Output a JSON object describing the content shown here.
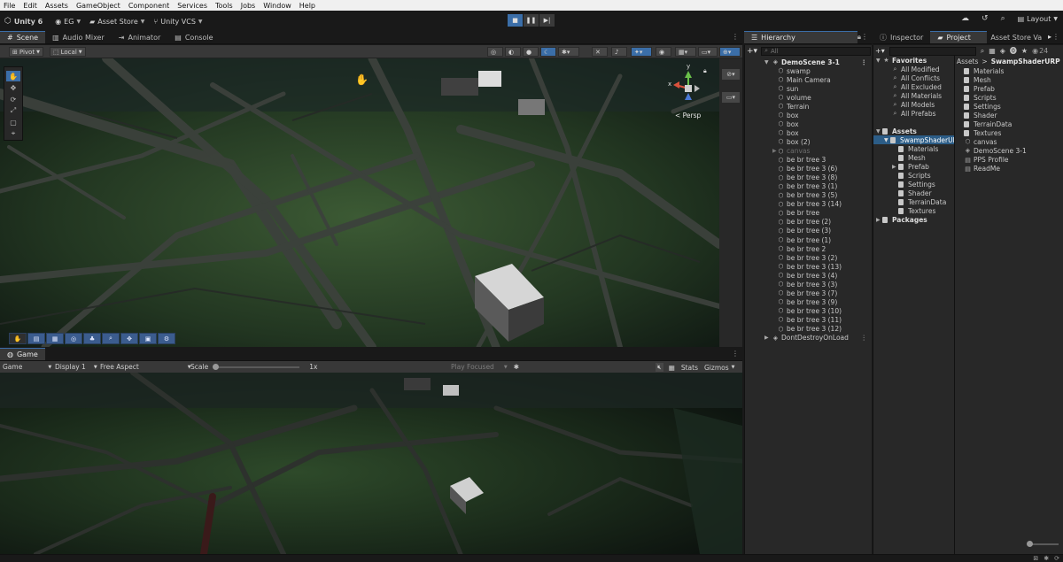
{
  "menu": [
    "File",
    "Edit",
    "Assets",
    "GameObject",
    "Component",
    "Services",
    "Tools",
    "Jobs",
    "Window",
    "Help"
  ],
  "toolbar": {
    "unity_label": "Unity 6",
    "account_label": "EG",
    "asset_store_label": "Asset Store",
    "vcs_label": "Unity VCS",
    "layout_label": "Layout"
  },
  "left_tabs": [
    {
      "label": "Scene",
      "icon": "scene-icon"
    },
    {
      "label": "Audio Mixer",
      "icon": "audio-mixer-icon"
    },
    {
      "label": "Animator",
      "icon": "animator-icon"
    },
    {
      "label": "Console",
      "icon": "console-icon"
    }
  ],
  "scene_toolbar": {
    "pivot_label": "Pivot",
    "local_label": "Local"
  },
  "gizmo": {
    "persp_label": "< Persp",
    "y_label": "y",
    "x_label": "x"
  },
  "game_tab": {
    "label": "Game"
  },
  "game_toolbar": {
    "game_label": "Game",
    "display_label": "Display 1",
    "aspect_label": "Free Aspect",
    "scale_label": "Scale",
    "scale_value": "1x",
    "play_focused_label": "Play Focused",
    "stats_label": "Stats",
    "gizmos_label": "Gizmos"
  },
  "hierarchy": {
    "tab_label": "Hierarchy",
    "search_placeholder": "All",
    "scene_name": "DemoScene 3-1",
    "items": [
      {
        "label": "swamp"
      },
      {
        "label": "Main Camera"
      },
      {
        "label": "sun"
      },
      {
        "label": "volume"
      },
      {
        "label": "Terrain"
      },
      {
        "label": "box"
      },
      {
        "label": "box"
      },
      {
        "label": "box"
      },
      {
        "label": "box (2)"
      },
      {
        "label": "canvas",
        "dim": true
      },
      {
        "label": "be br tree 3"
      },
      {
        "label": "be br tree 3 (6)"
      },
      {
        "label": "be br tree 3 (8)"
      },
      {
        "label": "be br tree 3 (1)"
      },
      {
        "label": "be br tree 3 (5)"
      },
      {
        "label": "be br tree 3 (14)"
      },
      {
        "label": "be br tree"
      },
      {
        "label": "be br tree (2)"
      },
      {
        "label": "be br tree (3)"
      },
      {
        "label": "be br tree (1)"
      },
      {
        "label": "be br tree 2"
      },
      {
        "label": "be br tree 3 (2)"
      },
      {
        "label": "be br tree 3 (13)"
      },
      {
        "label": "be br tree 3 (4)"
      },
      {
        "label": "be br tree 3 (3)"
      },
      {
        "label": "be br tree 3 (7)"
      },
      {
        "label": "be br tree 3 (9)"
      },
      {
        "label": "be br tree 3 (10)"
      },
      {
        "label": "be br tree 3 (11)"
      },
      {
        "label": "be br tree 3 (12)"
      }
    ],
    "dont_destroy": "DontDestroyOnLoad"
  },
  "right_tabs": {
    "inspector": "Inspector",
    "project": "Project",
    "asset_store": "Asset Store Va"
  },
  "project": {
    "count_label": "24",
    "favorites_label": "Favorites",
    "favorites": [
      "All Modified",
      "All Conflicts",
      "All Excluded",
      "All Materials",
      "All Models",
      "All Prefabs"
    ],
    "assets_label": "Assets",
    "selected_folder": "SwampShaderURP",
    "subfolders": [
      "Materials",
      "Mesh",
      "Prefab",
      "Scripts",
      "Settings",
      "Shader",
      "TerrainData",
      "Textures"
    ],
    "packages_label": "Packages",
    "breadcrumb_root": "Assets",
    "breadcrumb_sep": ">",
    "breadcrumb_current": "SwampShaderURP",
    "contents": [
      {
        "label": "Materials",
        "kind": "folder"
      },
      {
        "label": "Mesh",
        "kind": "folder"
      },
      {
        "label": "Prefab",
        "kind": "folder"
      },
      {
        "label": "Scripts",
        "kind": "folder"
      },
      {
        "label": "Settings",
        "kind": "folder"
      },
      {
        "label": "Shader",
        "kind": "folder"
      },
      {
        "label": "TerrainData",
        "kind": "folder"
      },
      {
        "label": "Textures",
        "kind": "folder"
      },
      {
        "label": "canvas",
        "kind": "prefab"
      },
      {
        "label": "DemoScene 3-1",
        "kind": "scene"
      },
      {
        "label": "PPS Profile",
        "kind": "asset"
      },
      {
        "label": "ReadMe",
        "kind": "asset"
      }
    ]
  },
  "colors": {
    "accent": "#3b6ea8",
    "panel": "#282828",
    "toolbar": "#383838",
    "background": "#191919"
  }
}
